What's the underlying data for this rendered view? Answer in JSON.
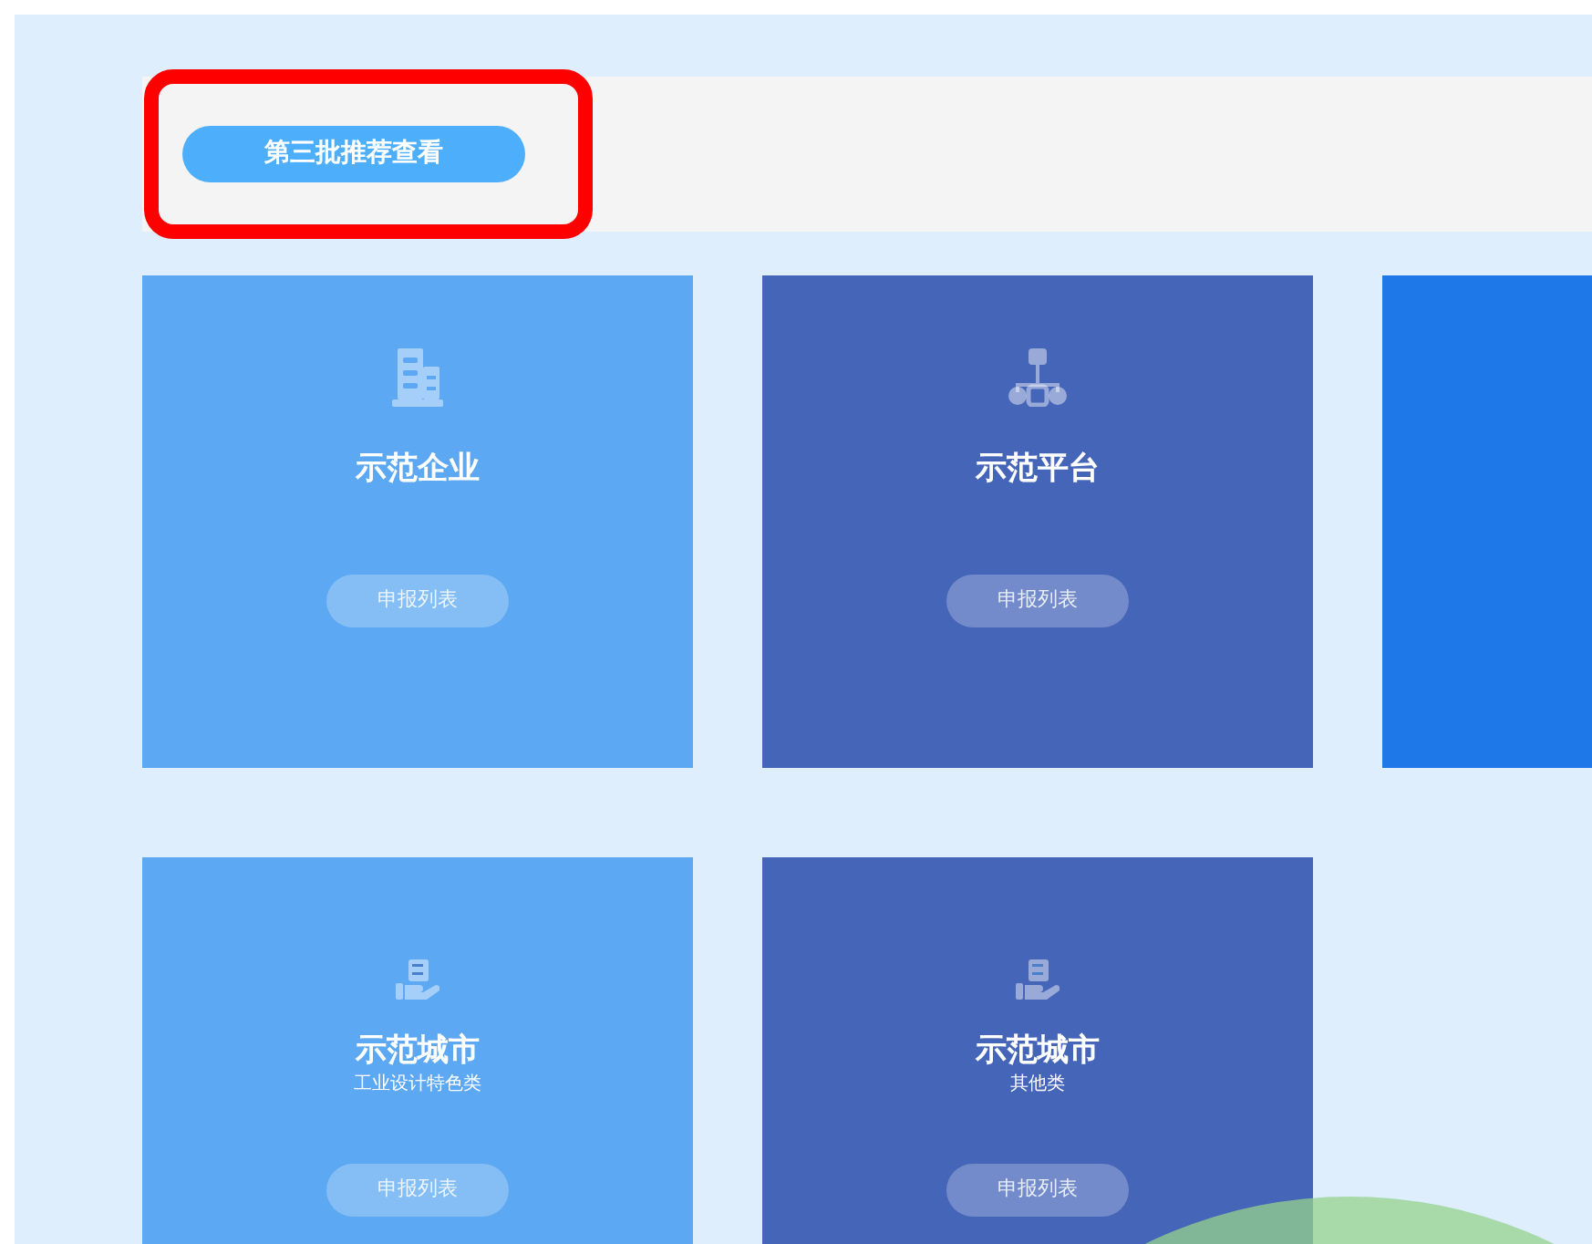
{
  "top_bar": {
    "button": "第三批推荐查看",
    "highlighted": true
  },
  "card_rows": [
    {
      "cards": [
        {
          "kind": "building",
          "title": "示范企业",
          "button": "申报列表",
          "color": "#5ca8f2"
        },
        {
          "kind": "network",
          "title": "示范平台",
          "button": "申报列表",
          "color": "#4565b8"
        },
        {
          "kind": "blank",
          "color": "#1e78e8"
        }
      ]
    },
    {
      "cards": [
        {
          "kind": "server",
          "title": "示范城市",
          "subtitle": "工业设计特色类",
          "button": "申报列表",
          "color": "#5ca8f2"
        },
        {
          "kind": "server",
          "title": "示范城市",
          "subtitle": "其他类",
          "button": "申报列表",
          "color": "#4565b8"
        }
      ]
    }
  ]
}
